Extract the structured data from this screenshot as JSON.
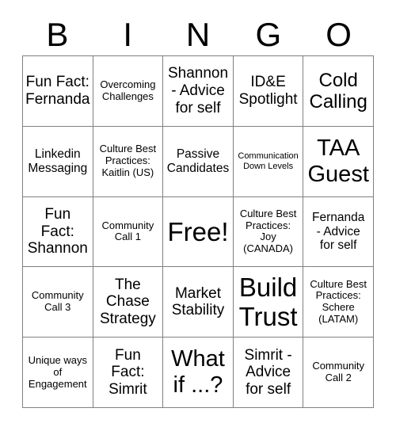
{
  "card": {
    "title_letters": [
      "B",
      "I",
      "N",
      "G",
      "O"
    ],
    "rows": [
      [
        {
          "text": "Fun Fact:\nFernanda",
          "size": "fs-l"
        },
        {
          "text": "Overcoming\nChallenges",
          "size": "fs-s"
        },
        {
          "text": "Shannon\n- Advice\nfor self",
          "size": "fs-l"
        },
        {
          "text": "ID&E\nSpotlight",
          "size": "fs-l"
        },
        {
          "text": "Cold\nCalling",
          "size": "fs-xl"
        }
      ],
      [
        {
          "text": "Linkedin\nMessaging",
          "size": "fs-m"
        },
        {
          "text": "Culture Best\nPractices:\nKaitlin (US)",
          "size": "fs-s"
        },
        {
          "text": "Passive\nCandidates",
          "size": "fs-m"
        },
        {
          "text": "Communication\nDown Levels",
          "size": "fs-xs"
        },
        {
          "text": "TAA\nGuest",
          "size": "fs-xxl"
        }
      ],
      [
        {
          "text": "Fun\nFact:\nShannon",
          "size": "fs-l"
        },
        {
          "text": "Community\nCall 1",
          "size": "fs-s"
        },
        {
          "text": "Free!",
          "size": "fs-huge"
        },
        {
          "text": "Culture Best\nPractices:\nJoy\n(CANADA)",
          "size": "fs-s"
        },
        {
          "text": "Fernanda\n- Advice\nfor self",
          "size": "fs-m"
        }
      ],
      [
        {
          "text": "Community\nCall 3",
          "size": "fs-s"
        },
        {
          "text": "The\nChase\nStrategy",
          "size": "fs-l"
        },
        {
          "text": "Market\nStability",
          "size": "fs-l"
        },
        {
          "text": "Build\nTrust",
          "size": "fs-huge"
        },
        {
          "text": "Culture Best\nPractices:\nSchere\n(LATAM)",
          "size": "fs-s"
        }
      ],
      [
        {
          "text": "Unique ways\nof\nEngagement",
          "size": "fs-s"
        },
        {
          "text": "Fun\nFact:\nSimrit",
          "size": "fs-l"
        },
        {
          "text": "What\nif ...?",
          "size": "fs-xxl"
        },
        {
          "text": "Simrit -\nAdvice\nfor self",
          "size": "fs-l"
        },
        {
          "text": "Community\nCall 2",
          "size": "fs-s"
        }
      ]
    ]
  }
}
